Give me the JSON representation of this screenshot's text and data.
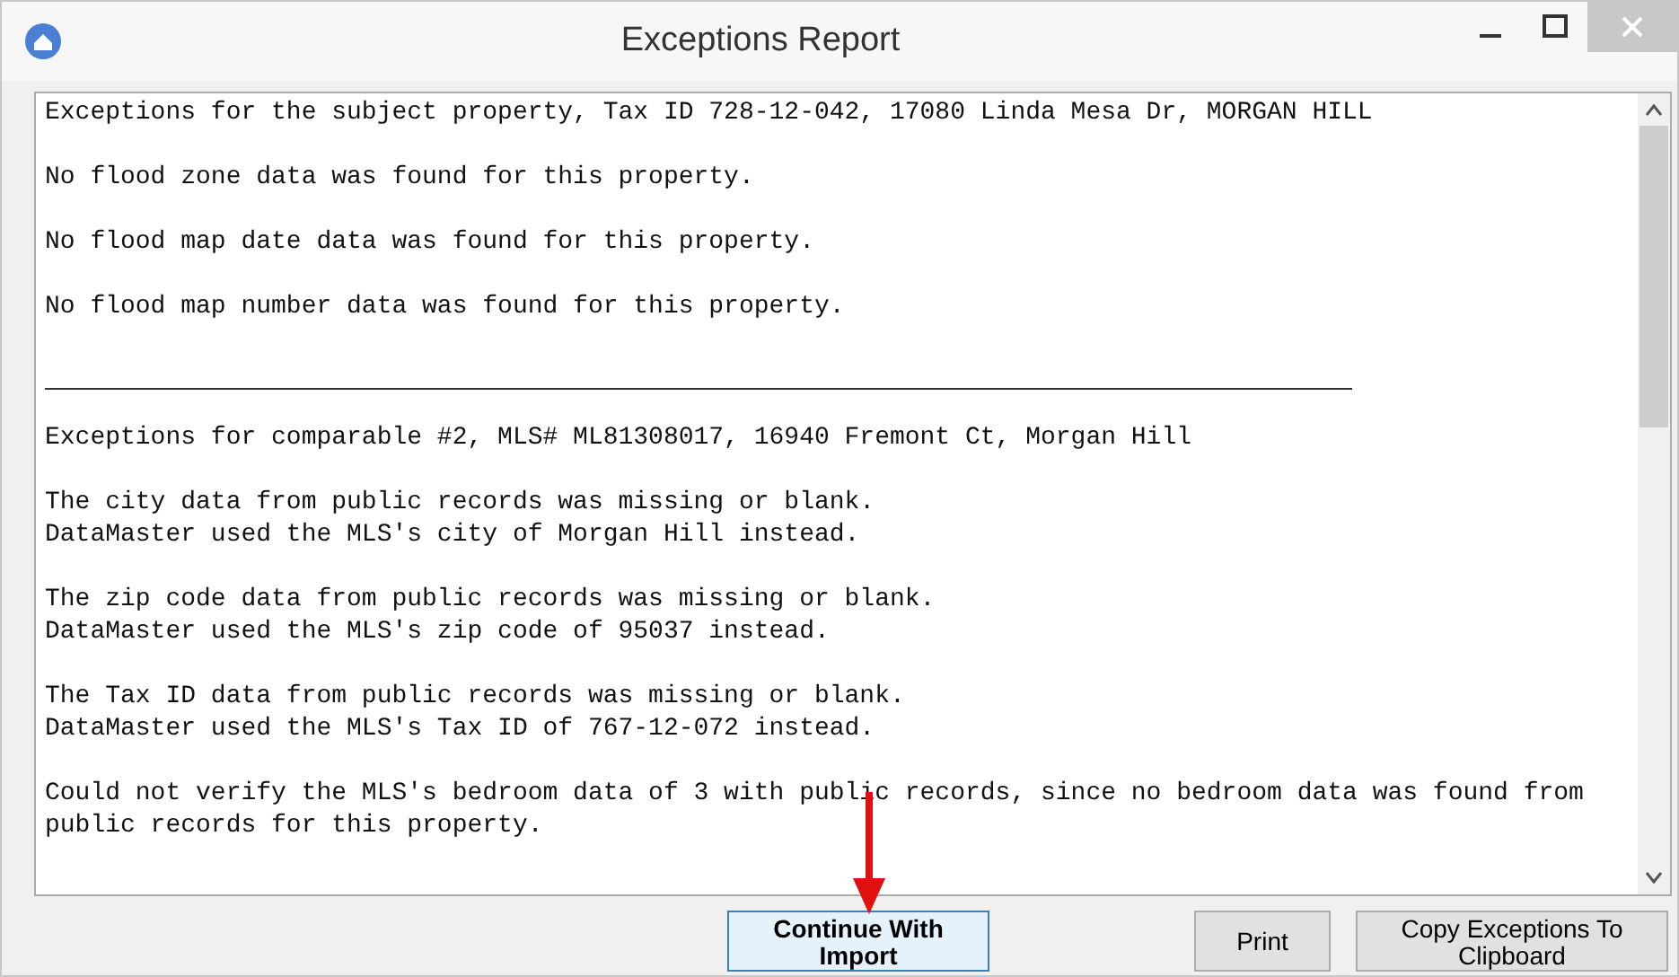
{
  "window": {
    "title": "Exceptions Report"
  },
  "report": [
    {
      "kind": "text",
      "lines": [
        "Exceptions for the subject property, Tax ID 728-12-042, 17080 Linda Mesa Dr, MORGAN HILL"
      ]
    },
    {
      "kind": "text",
      "lines": [
        "No flood zone data was found for this property."
      ]
    },
    {
      "kind": "text",
      "lines": [
        "No flood map date data was found for this property."
      ]
    },
    {
      "kind": "text",
      "lines": [
        "No flood map number data was found for this property."
      ]
    },
    {
      "kind": "rule"
    },
    {
      "kind": "text",
      "lines": [
        "Exceptions for comparable #2, MLS# ML81308017, 16940 Fremont Ct, Morgan Hill"
      ]
    },
    {
      "kind": "text",
      "lines": [
        "The city data from public records was missing or blank.",
        "DataMaster used the MLS's city of Morgan Hill instead."
      ]
    },
    {
      "kind": "text",
      "lines": [
        "The zip code data from public records was missing or blank.",
        "DataMaster used the MLS's zip code of 95037 instead."
      ]
    },
    {
      "kind": "text",
      "lines": [
        "The Tax ID data from public records was missing or blank.",
        "DataMaster used the MLS's Tax ID of 767-12-072 instead."
      ]
    },
    {
      "kind": "text",
      "lines": [
        "Could not verify the MLS's bedroom data of 3 with public records, since no bedroom data was found from",
        "public records for this property."
      ]
    }
  ],
  "buttons": [
    {
      "label": "Continue With Import",
      "bold": true,
      "focused": true
    },
    {
      "label": "Print",
      "bold": false,
      "focused": false
    },
    {
      "label": "Copy Exceptions To Clipboard",
      "bold": false,
      "focused": false
    }
  ]
}
